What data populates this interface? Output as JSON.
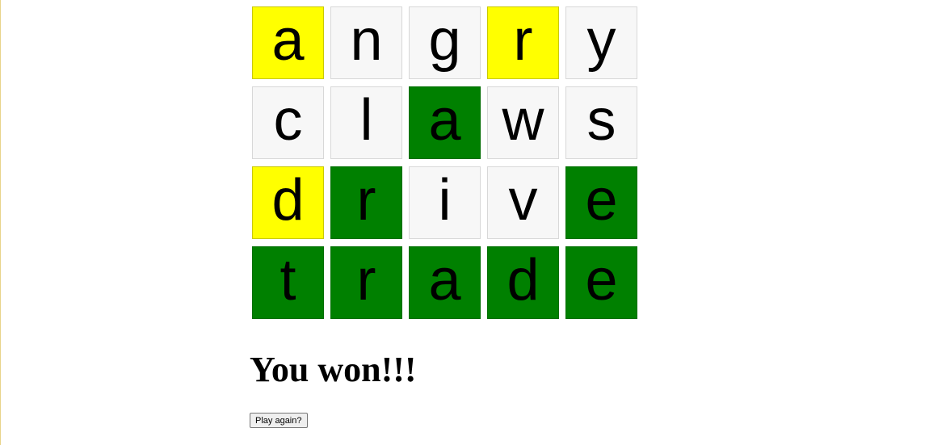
{
  "board": {
    "rows": [
      {
        "letters": [
          "a",
          "n",
          "g",
          "r",
          "y"
        ],
        "states": [
          "present",
          "absent",
          "absent",
          "present",
          "absent"
        ]
      },
      {
        "letters": [
          "c",
          "l",
          "a",
          "w",
          "s"
        ],
        "states": [
          "absent",
          "absent",
          "correct",
          "absent",
          "absent"
        ]
      },
      {
        "letters": [
          "d",
          "r",
          "i",
          "v",
          "e"
        ],
        "states": [
          "present",
          "correct",
          "absent",
          "absent",
          "correct"
        ]
      },
      {
        "letters": [
          "t",
          "r",
          "a",
          "d",
          "e"
        ],
        "states": [
          "correct",
          "correct",
          "correct",
          "correct",
          "correct"
        ]
      }
    ]
  },
  "colors": {
    "correct": "#008000",
    "present": "#ffff00",
    "absent": "#f7f7f7"
  },
  "result": {
    "message": "You won!!!"
  },
  "controls": {
    "play_again_label": "Play again?"
  }
}
